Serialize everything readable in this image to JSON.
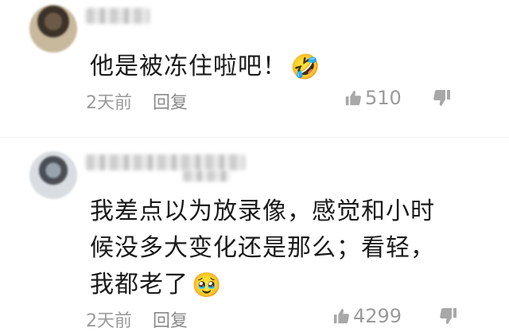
{
  "comments": [
    {
      "text_lines": [
        "他是被冻住啦吧！"
      ],
      "emoji": "🤣",
      "time": "2天前",
      "reply_label": "回复",
      "likes": "510"
    },
    {
      "text_lines": [
        "我差点以为放录像，感觉和小时",
        "候没多大变化还是那么；看轻，",
        "我都老了"
      ],
      "emoji": "🥹",
      "time": "2天前",
      "reply_label": "回复",
      "likes": "4299"
    }
  ],
  "icons": {
    "like": "thumbs-up-icon",
    "dislike": "thumbs-down-icon"
  },
  "colors": {
    "text": "#1a1a1a",
    "meta": "#9a9a9a"
  }
}
